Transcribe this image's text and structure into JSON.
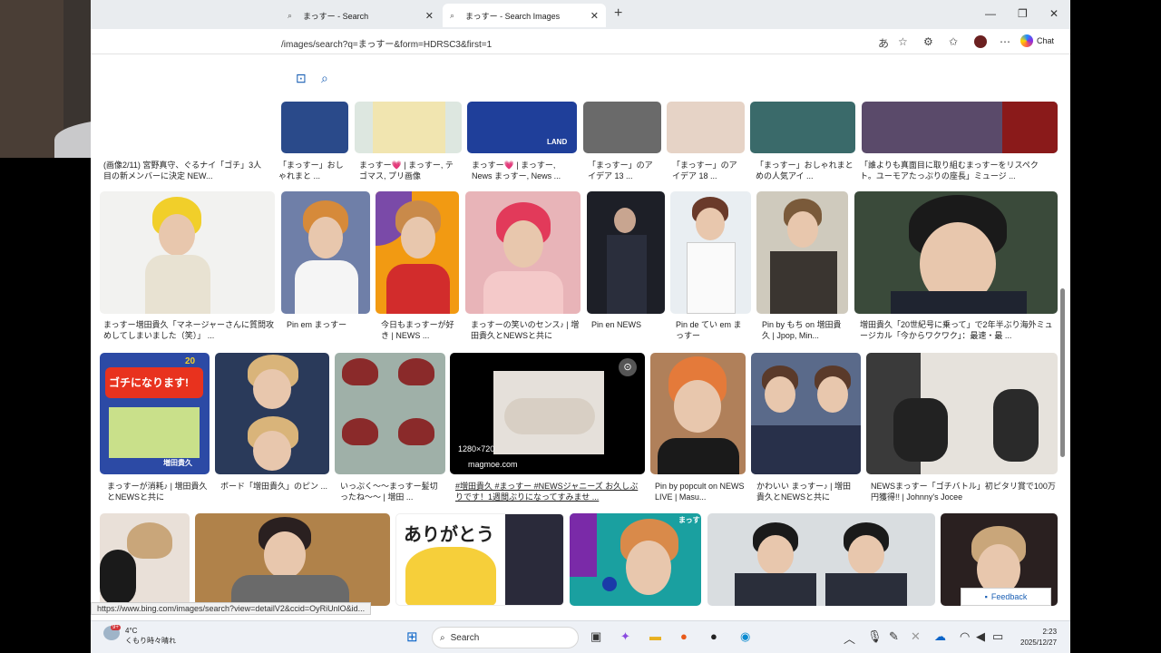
{
  "browser": {
    "tabs": [
      {
        "label": "まっすー - Search",
        "icon": "search-icon"
      },
      {
        "label": "まっすー - Search Images",
        "icon": "search-icon"
      }
    ],
    "new_tab": "+",
    "url": "/images/search?q=まっすー&form=HDRSC3&first=1",
    "chat_label": "Chat",
    "window_controls": {
      "minimize": "—",
      "maximize": "❐",
      "close": "✕"
    }
  },
  "results": {
    "row1_captions": [
      "(画像2/11) 宮野真守、ぐるナイ「ゴチ」3人目の新メンバーに決定 NEW...",
      "「まっすー」おしゃれまと ...",
      "まっすー💗 | まっすー, テゴマス, プリ画像",
      "まっすー💗 | まっすー, News まっすー, News ...",
      "「まっすー」のアイデア 13 ...",
      "「まっすー」のアイデア 18 ...",
      "「まっすー」おしゃれまとめの人気アイ ...",
      "「誰よりも真面目に取り組むまっすーをリスペクト。ユーモアたっぷりの座長」ミュージ ..."
    ],
    "row2_captions": [
      "まっすー増田貴久「マネージャーさんに質問攻めしてしまいました（笑）」 ...",
      "Pin em まっすー",
      "今日もまっすーが好き | NEWS ...",
      "まっすーの笑いのセンス♪ | 増田貴久とNEWSと共に",
      "Pin en NEWS",
      "Pin de てい em まっすー",
      "Pin by もち on 増田貴久 | Jpop, Min...",
      "増田貴久「20世紀号に乗って」で2年半ぶり海外ミュージカル「今からワクワク」：最速・最 ..."
    ],
    "row3_captions": [
      "まっすーが消耗♪ | 増田貴久とNEWSと共に",
      "ボード「増田貴久」のピン ...",
      "いっぷく〜〜まっすー髪切ったね〜〜 | 増田 ...",
      "#増田貴久 #まっすー #NEWSジャニーズ お久しぶりです！1週間ぶりになってすみませ ...",
      "Pin by popcult on NEWS LIVE | Masu...",
      "かわいい まっすー♪ | 増田貴久とNEWSと共に",
      "NEWSまっすー「ゴチバトル」初ピタリ賞で100万円獲得!! | Johnny's Jocee"
    ],
    "hover_card": {
      "dimensions": "1280×720",
      "source": "magmoe.com"
    },
    "row1_tile_text": "LAND",
    "row3_tile_text": [
      "ゴチになります!",
      "20",
      "増田貴久"
    ],
    "row4_tile_text": [
      "ありがとう",
      "まっす"
    ]
  },
  "status_url": "https://www.bing.com/images/search?view=detailV2&ccid=OyRiUnlO&id...",
  "feedback_label": "Feedback",
  "taskbar": {
    "weather_temp": "4°C",
    "weather_desc": "くもり時々晴れ",
    "weather_badge": "9+",
    "search_placeholder": "Search",
    "time": "2:23",
    "date": "2025/12/27"
  },
  "colors": {
    "accent": "#1a5fb4",
    "tabbar": "#e9ecef",
    "taskbar": "#eef1f6"
  }
}
